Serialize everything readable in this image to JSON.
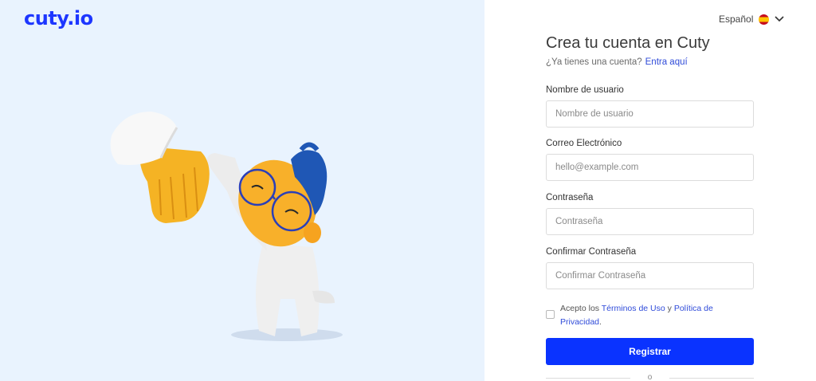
{
  "brand": {
    "logo_text": "cuty.io",
    "accent_color": "#0a33ff"
  },
  "language": {
    "selected": "Español",
    "flag_icon": "spain-flag-icon",
    "dropdown_icon": "chevron-down-icon"
  },
  "form": {
    "title": "Crea tu cuenta en Cuty",
    "have_account_text": "¿Ya tienes una cuenta?",
    "login_link": "Entra aquí",
    "fields": [
      {
        "label": "Nombre de usuario",
        "placeholder": "Nombre de usuario"
      },
      {
        "label": "Correo Electrónico",
        "placeholder": "hello@example.com"
      },
      {
        "label": "Contraseña",
        "placeholder": "Contraseña"
      },
      {
        "label": "Confirmar Contraseña",
        "placeholder": "Confirmar Contraseña"
      }
    ],
    "terms": {
      "prefix": "Acepto los",
      "terms_link": "Términos de Uso",
      "conjunction": "y",
      "privacy_link": "Política de Privacidad",
      "suffix": "."
    },
    "submit_label": "Registrar",
    "divider_text": "o"
  }
}
